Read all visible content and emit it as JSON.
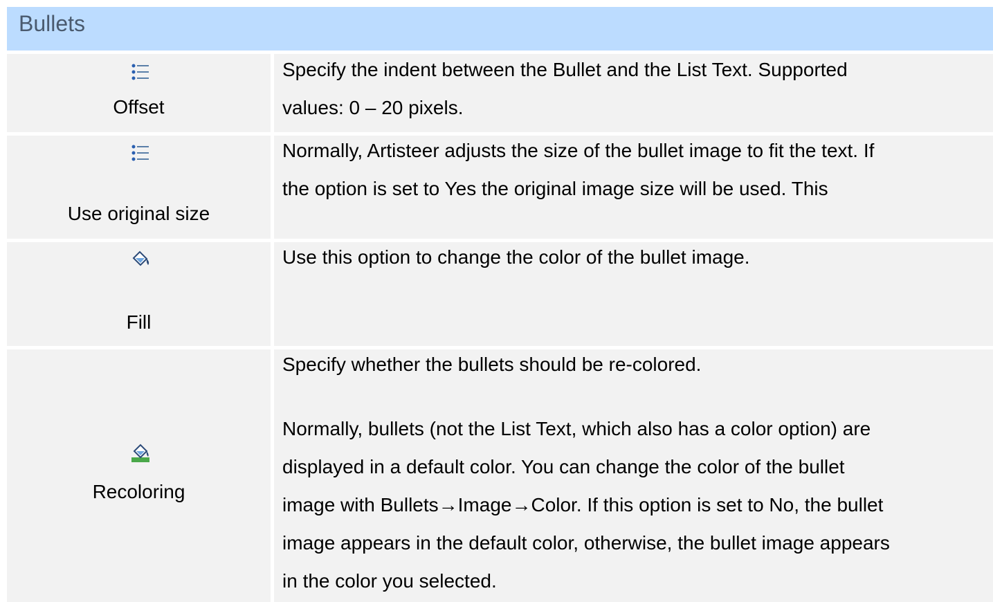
{
  "section": {
    "title": "Bullets"
  },
  "rows": [
    {
      "icon": "bulleted-list-icon",
      "label": "Offset",
      "lines": [
        "Specify the indent between the Bullet and the List Text. Supported",
        "values: 0 – 20 pixels."
      ]
    },
    {
      "icon": "bulleted-list-icon",
      "label": "Use original size",
      "lines": [
        "Normally, Artisteer adjusts the size of the bullet image to fit the text. If",
        "the option is set to Yes the original image size will be used. This"
      ]
    },
    {
      "icon": "paint-bucket-icon",
      "label": "Fill",
      "lines": [
        "Use this option to change the color of the bullet image."
      ]
    },
    {
      "icon": "recolor-bucket-icon",
      "label": "Recoloring",
      "lines": [
        "Specify whether the bullets should be re-colored.",
        "Normally, bullets (not the List Text, which also has a color option) are",
        "displayed in a default color.  You can change the color of the bullet",
        "image with Bullets→Image→Color.  If this option is set to No, the bullet",
        "image appears in the default color, otherwise, the bullet image appears",
        "in the color you selected."
      ]
    }
  ]
}
